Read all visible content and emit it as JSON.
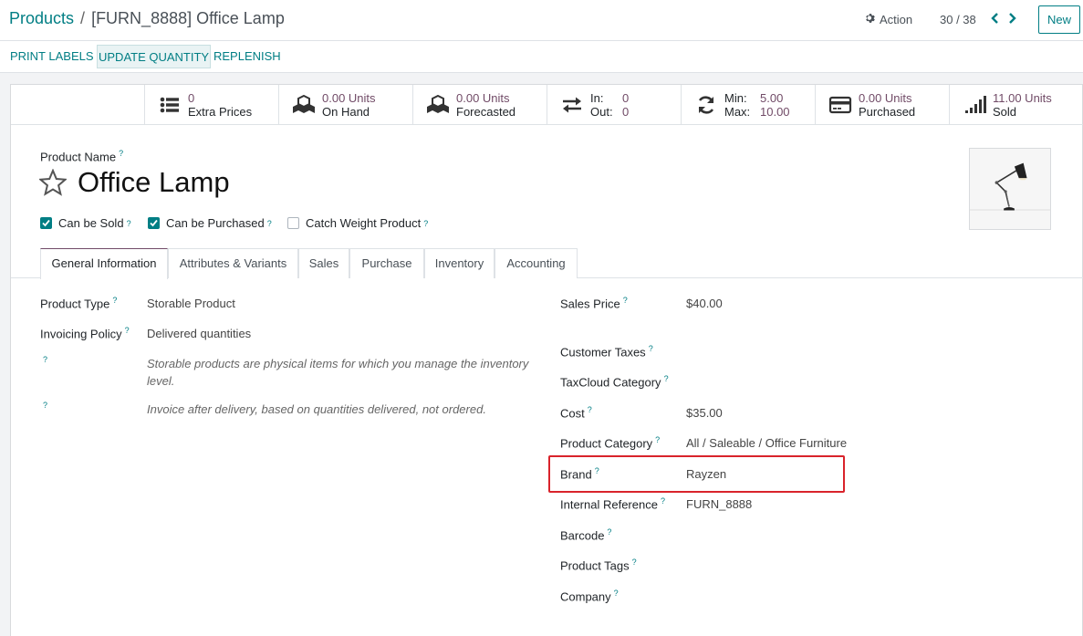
{
  "breadcrumb": {
    "parent": "Products",
    "separator": "/",
    "current": "[FURN_8888] Office Lamp"
  },
  "control": {
    "action_label": "Action",
    "pager": "30 / 38",
    "new_label": "New"
  },
  "header_buttons": {
    "print_labels": "PRINT LABELS",
    "update_quantity": "UPDATE QUANTITY",
    "replenish": "REPLENISH"
  },
  "smart_buttons": {
    "extra_prices": {
      "value": "0",
      "label": "Extra Prices",
      "icon": "list-icon"
    },
    "on_hand": {
      "value": "0.00 Units",
      "label": "On Hand",
      "icon": "cubes-icon"
    },
    "forecasted": {
      "value": "0.00 Units",
      "label": "Forecasted",
      "icon": "cubes-icon"
    },
    "in_out": {
      "in_label": "In:",
      "in_value": "0",
      "out_label": "Out:",
      "out_value": "0",
      "icon": "exchange-icon"
    },
    "min_max": {
      "min_label": "Min:",
      "min_value": "5.00",
      "max_label": "Max:",
      "max_value": "10.00",
      "icon": "refresh-icon"
    },
    "purchased": {
      "value": "0.00 Units",
      "label": "Purchased",
      "icon": "credit-card-icon"
    },
    "sold": {
      "value": "11.00 Units",
      "label": "Sold",
      "icon": "signal-icon"
    }
  },
  "product": {
    "name_label": "Product Name",
    "help_mark": "?",
    "name": "Office Lamp",
    "can_be_sold": {
      "label": "Can be Sold",
      "checked": true
    },
    "can_be_purchased": {
      "label": "Can be Purchased",
      "checked": true
    },
    "catch_weight": {
      "label": "Catch Weight Product",
      "checked": false
    }
  },
  "tabs": [
    "General Information",
    "Attributes & Variants",
    "Sales",
    "Purchase",
    "Inventory",
    "Accounting"
  ],
  "general": {
    "product_type_label": "Product Type",
    "product_type": "Storable Product",
    "invoicing_policy_label": "Invoicing Policy",
    "invoicing_policy": "Delivered quantities",
    "help_storable": "Storable products are physical items for which you manage the inventory level.",
    "help_invoice": "Invoice after delivery, based on quantities delivered, not ordered.",
    "sales_price_label": "Sales Price",
    "sales_price": "$40.00",
    "customer_taxes_label": "Customer Taxes",
    "taxcloud_label": "TaxCloud Category",
    "cost_label": "Cost",
    "cost": "$35.00",
    "category_label": "Product Category",
    "category": "All / Saleable / Office Furniture",
    "brand_label": "Brand",
    "brand": "Rayzen",
    "internal_ref_label": "Internal Reference",
    "internal_ref": "FURN_8888",
    "barcode_label": "Barcode",
    "tags_label": "Product Tags",
    "company_label": "Company"
  },
  "colors": {
    "primary": "#017e84",
    "accent": "#714b67",
    "highlight": "#d9232b"
  }
}
